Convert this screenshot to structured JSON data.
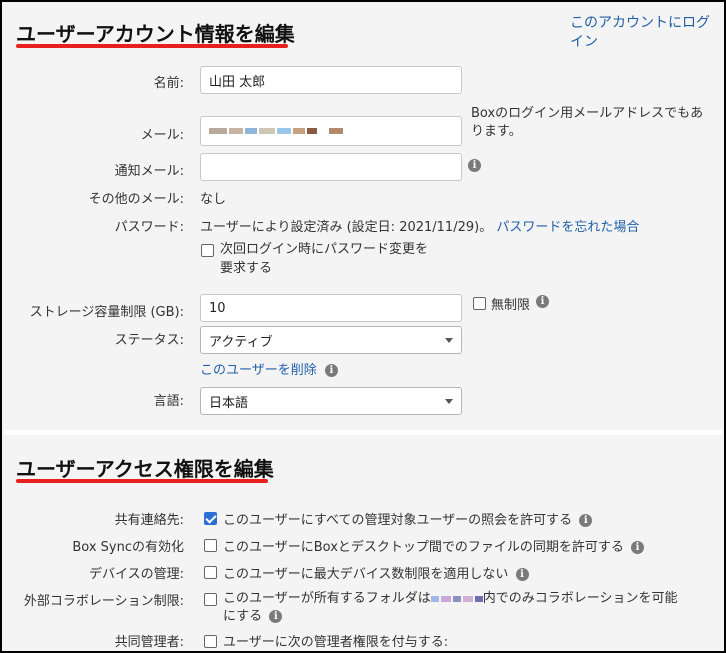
{
  "account_section": {
    "title": "ユーザーアカウント情報を編集",
    "login_link": "このアカウントにログイン",
    "name": {
      "label": "名前:",
      "value": "山田 太郎"
    },
    "email": {
      "label": "メール:",
      "note": "Boxのログイン用メールアドレスでもあります。"
    },
    "notify_email": {
      "label": "通知メール:",
      "value": ""
    },
    "other_email": {
      "label": "その他のメール:",
      "value": "なし"
    },
    "password": {
      "label": "パスワード:",
      "status": "ユーザーにより設定済み (設定日: 2021/11/29)。",
      "forgot_link": "パスワードを忘れた場合",
      "require_change_line1": "次回ログイン時にパスワード変更を",
      "require_change_line2": "要求する"
    },
    "storage": {
      "label": "ストレージ容量制限 (GB):",
      "value": "10",
      "unlimited_label": "無制限"
    },
    "status": {
      "label": "ステータス:",
      "value": "アクティブ",
      "delete_link": "このユーザーを削除"
    },
    "language": {
      "label": "言語:",
      "value": "日本語"
    }
  },
  "access_section": {
    "title": "ユーザーアクセス権限を編集",
    "rows": [
      {
        "label": "共有連絡先:",
        "text": "このユーザーにすべての管理対象ユーザーの照会を許可する",
        "checked": true
      },
      {
        "label": "Box Syncの有効化",
        "text": "このユーザーにBoxとデスクトップ間でのファイルの同期を許可する",
        "checked": false
      },
      {
        "label": "デバイスの管理:",
        "text": "このユーザーに最大デバイス数制限を適用しない",
        "checked": false
      },
      {
        "label": "外部コラボレーション制限:",
        "text_line1": "このユーザーが所有するフォルダは",
        "text_line1b": "内でのみコラボレーションを可能",
        "text_line2": "にする",
        "checked": false
      },
      {
        "label": "共同管理者:",
        "text": "ユーザーに次の管理者権限を付与する:",
        "checked": false
      }
    ]
  },
  "icons": {
    "info": "info-icon",
    "caret": "chevron-down-icon",
    "checkbox": "checkbox-icon"
  },
  "colors": {
    "accent_underline": "#e8201d",
    "link": "#1f5fa8",
    "checkbox_checked": "#2a6fd6"
  }
}
